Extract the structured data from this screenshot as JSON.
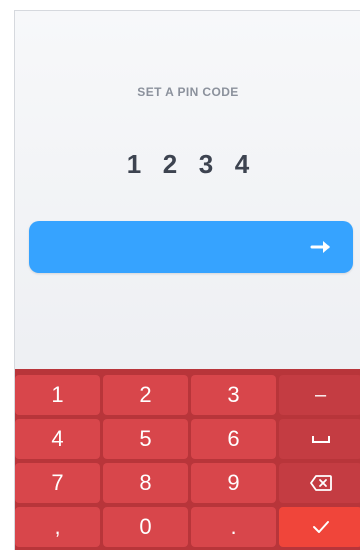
{
  "title": "SET A PIN CODE",
  "pin_digits": [
    "1",
    "2",
    "3",
    "4"
  ],
  "next_button": {
    "icon": "arrow-right-icon"
  },
  "keyboard": {
    "keys": [
      {
        "label": "1",
        "name": "key-1"
      },
      {
        "label": "2",
        "name": "key-2"
      },
      {
        "label": "3",
        "name": "key-3"
      },
      {
        "label": "–",
        "name": "key-minus"
      },
      {
        "label": "4",
        "name": "key-4"
      },
      {
        "label": "5",
        "name": "key-5"
      },
      {
        "label": "6",
        "name": "key-6"
      },
      {
        "label": "",
        "name": "key-space",
        "icon": "space-icon"
      },
      {
        "label": "7",
        "name": "key-7"
      },
      {
        "label": "8",
        "name": "key-8"
      },
      {
        "label": "9",
        "name": "key-9"
      },
      {
        "label": "",
        "name": "key-backspace",
        "icon": "backspace-icon"
      },
      {
        "label": ",",
        "name": "key-comma"
      },
      {
        "label": "0",
        "name": "key-0"
      },
      {
        "label": ".",
        "name": "key-period"
      },
      {
        "label": "",
        "name": "key-done",
        "icon": "checkmark-icon"
      }
    ]
  },
  "colors": {
    "accent": "#36a3ff",
    "keyboard_bg": "#b8353a",
    "key_bg": "#d8464b",
    "done_key": "#f0453a"
  }
}
